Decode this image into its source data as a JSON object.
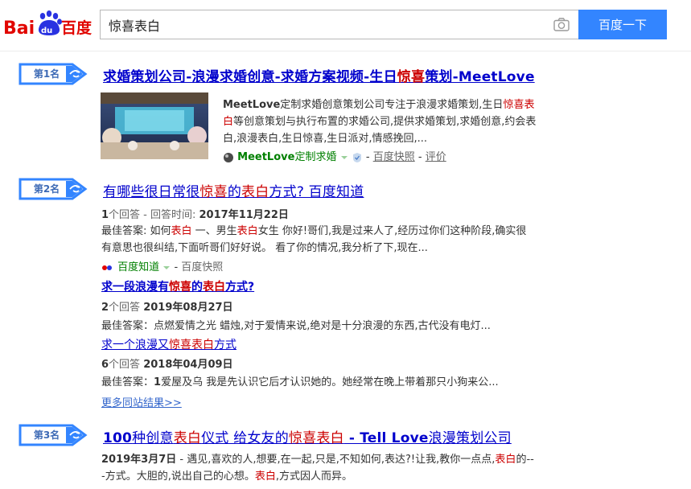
{
  "logo": {
    "text_bai": "Bai",
    "text_du": "du",
    "text_cn": "百度"
  },
  "search": {
    "query": "惊喜表白",
    "button_label": "百度一下"
  },
  "results": [
    {
      "rank": "第1名",
      "title_parts": [
        "求婚策划公司-浪漫求婚创意-求婚方案视频-生日",
        "惊喜",
        "策划-MeetLove"
      ],
      "desc_line1_parts": [
        "MeetLove",
        "定制求婚创意策划公司专注于浪漫求婚策划,生日",
        "惊喜表"
      ],
      "desc_line2_parts": [
        "白",
        "等创意策划与执行布置的求婚公司,提供求婚策划,求婚创意,约会表"
      ],
      "desc_line3": "白,浪漫表白,生日惊喜,生日派对,情感挽回,...",
      "site_name": "MeetLove",
      "site_suffix": "定制求婚",
      "snapshot": "百度快照",
      "review": "评价"
    },
    {
      "rank": "第2名",
      "title_parts": [
        "有哪些很日常很",
        "惊喜",
        "的",
        "表白",
        "方式? 百度知道"
      ],
      "meta_parts": [
        "1",
        "个回答 - 回答时间: ",
        "2017年11月22日"
      ],
      "desc_line1_parts": [
        "最佳答案: 如何",
        "表白",
        " 一、男生",
        "表白",
        "女生 你好!哥们,我是过来人了,经历过你们这种阶段,确实很"
      ],
      "desc_line2": "有意思也很纠结,下面听哥们好好说。 看了你的情况,我分析了下,现在...",
      "site_name": "百度知道",
      "snapshot": "百度快照",
      "subs": [
        {
          "title_parts": [
            "求一段浪漫有",
            "惊喜",
            "的",
            "表白",
            "方式?"
          ],
          "meta_parts": [
            "2",
            "个回答 ",
            "2019年08月27日"
          ],
          "answer": "最佳答案：点燃爱情之光 蜡烛,对于爱情来说,绝对是十分浪漫的东西,古代没有电灯..."
        },
        {
          "title_parts": [
            "求一个浪漫又",
            "惊喜",
            "表白",
            "方式"
          ],
          "meta_parts": [
            "6",
            "个回答 ",
            "2018年04月09日"
          ],
          "answer_parts": [
            "最佳答案：",
            "1",
            "爱屋及乌 我是先认识它后才认识她的。她经常在晚上带着那只小狗来公..."
          ]
        }
      ],
      "more": "更多同站结果>>"
    },
    {
      "rank": "第3名",
      "title_parts": [
        "100",
        "种创意",
        "表白",
        "仪式 给女友的",
        "惊喜表白",
        " - Tell Love",
        "浪漫策划公司"
      ],
      "desc_line1_parts": [
        "2019年3月7日",
        " - 遇见,喜欢的人,想要,在一起,只是,不知如何,表达?!让我,教你一点点,",
        "表白",
        "的--"
      ],
      "desc_line2_parts": [
        "-方式。大胆的,说出自己的心想。",
        "表白",
        ",方式因人而异。"
      ]
    }
  ],
  "colors": {
    "accent": "#3385ff",
    "link": "#0000cc",
    "highlight": "#cc0000",
    "site": "#008000"
  },
  "icons": [
    "baidu-paw-icon",
    "camera-icon",
    "rank-badge-icon",
    "verified-icon",
    "dropdown-arrow-icon"
  ]
}
